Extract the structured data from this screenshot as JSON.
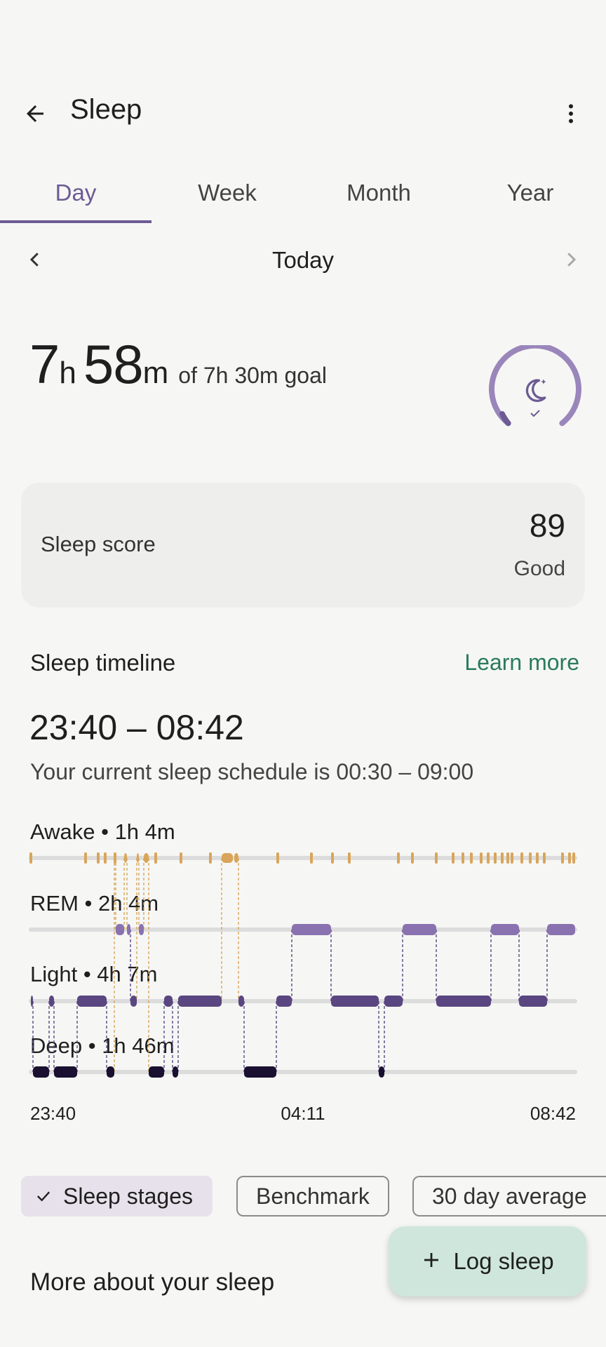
{
  "header": {
    "title": "Sleep"
  },
  "tabs": [
    {
      "label": "Day",
      "active": true
    },
    {
      "label": "Week",
      "active": false
    },
    {
      "label": "Month",
      "active": false
    },
    {
      "label": "Year",
      "active": false
    }
  ],
  "date_nav": {
    "label": "Today"
  },
  "summary": {
    "hours": "7",
    "hours_unit": "h",
    "minutes": "58",
    "minutes_unit": "m",
    "goal_text": "of 7h 30m goal",
    "goal_progress": 1.0
  },
  "score": {
    "label": "Sleep score",
    "value": "89",
    "rating": "Good"
  },
  "timeline": {
    "title": "Sleep timeline",
    "learn_more": "Learn more",
    "range": "23:40 – 08:42",
    "schedule": "Your current sleep schedule is 00:30 – 09:00",
    "stages": {
      "awake": "Awake • 1h 4m",
      "rem": "REM • 2h 4m",
      "light": "Light • 4h 7m",
      "deep": "Deep • 1h 46m"
    },
    "times": {
      "start": "23:40",
      "mid": "04:11",
      "end": "08:42"
    }
  },
  "chips": {
    "sleep_stages": "Sleep stages",
    "benchmark": "Benchmark",
    "thirty_day": "30 day average"
  },
  "more": {
    "title": "More about your sleep"
  },
  "fab": {
    "label": "Log sleep"
  },
  "colors": {
    "accent": "#6d5b94",
    "awake": "#d9a55a",
    "rem": "#8a72b0",
    "light": "#5a4680",
    "deep": "#1a1030",
    "link": "#2a7a5c"
  }
}
